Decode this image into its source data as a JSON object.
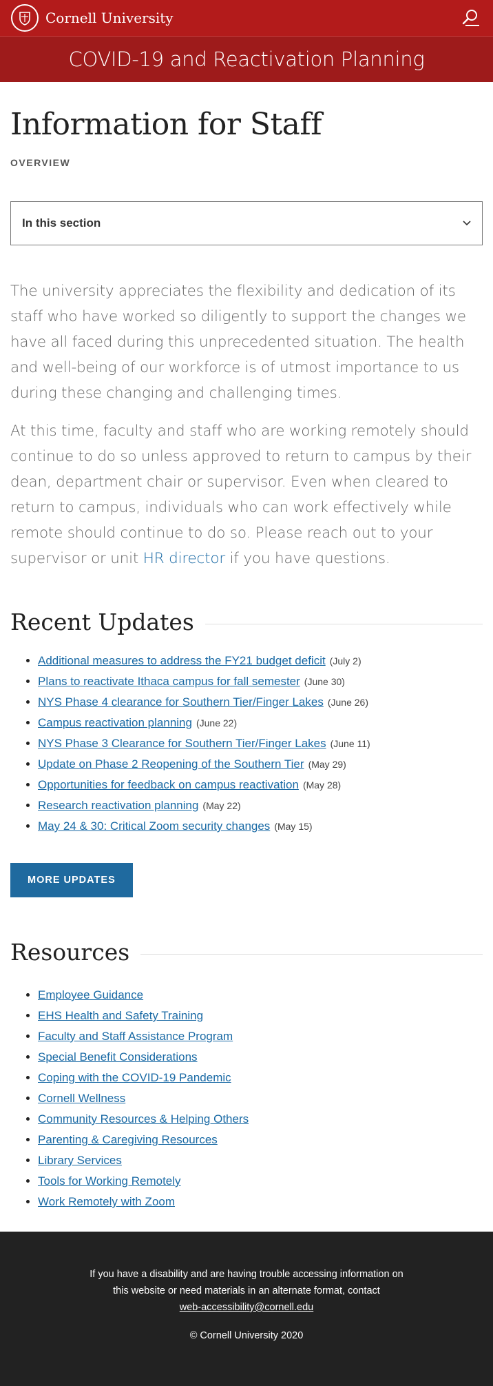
{
  "header": {
    "brand": "Cornell University",
    "search_icon": "search-user-icon",
    "seal_icon": "cornell-seal-icon"
  },
  "banner": {
    "title": "COVID-19 and Reactivation Planning"
  },
  "page": {
    "title": "Information for Staff",
    "subtitle": "OVERVIEW",
    "section_select": "In this section"
  },
  "intro": {
    "p1": "The university appreciates the flexibility and dedication of its staff who have worked so diligently to support the changes we have all faced during this unprecedented situation. The health and well-being of our workforce is of utmost importance to us during these changing and challenging times.",
    "p2_before": "At this time, faculty and staff who are working remotely should continue to do so unless approved to return to campus by their dean, department chair or supervisor. Even when cleared to return to campus, individuals who can work effectively while remote should continue to do so. Please reach out to your supervisor or unit ",
    "p2_link": "HR director",
    "p2_after": " if you have questions."
  },
  "updates": {
    "heading": "Recent Updates",
    "items": [
      {
        "label": "Additional measures to address the FY21 budget deficit",
        "date": "(July 2)"
      },
      {
        "label": "Plans to reactivate Ithaca campus for fall semester",
        "date": "(June 30)"
      },
      {
        "label": "NYS Phase 4 clearance for Southern Tier/Finger Lakes",
        "date": "(June 26)"
      },
      {
        "label": "Campus reactivation planning",
        "date": "(June 22)"
      },
      {
        "label": "NYS Phase 3 Clearance for Southern Tier/Finger Lakes",
        "date": "(June 11)"
      },
      {
        "label": "Update on Phase 2 Reopening of the Southern Tier",
        "date": "(May 29)"
      },
      {
        "label": "Opportunities for feedback on campus reactivation",
        "date": "(May 28)"
      },
      {
        "label": "Research reactivation planning",
        "date": "(May 22)"
      },
      {
        "label": "May 24 & 30: Critical Zoom security changes",
        "date": "(May 15)"
      }
    ],
    "more_button": "MORE UPDATES"
  },
  "resources": {
    "heading": "Resources",
    "items": [
      "Employee Guidance",
      "EHS Health and Safety Training",
      "Faculty and Staff Assistance Program",
      "Special Benefit Considerations",
      "Coping with the COVID-19 Pandemic",
      "Cornell Wellness",
      "Community Resources & Helping Others",
      "Parenting & Caregiving Resources",
      "Library Services",
      "Tools for Working Remotely",
      "Work Remotely with Zoom"
    ]
  },
  "footer": {
    "text": "If you have a disability and are having trouble accessing information on this website or need materials in an alternate format, contact",
    "email": "web-accessibility@cornell.edu",
    "copyright": "© Cornell University 2020"
  },
  "colors": {
    "topbar": "#b31b1b",
    "banner": "#9e1b1b",
    "link": "#1a6aa5",
    "button": "#1f6a9f",
    "footer": "#222222"
  }
}
